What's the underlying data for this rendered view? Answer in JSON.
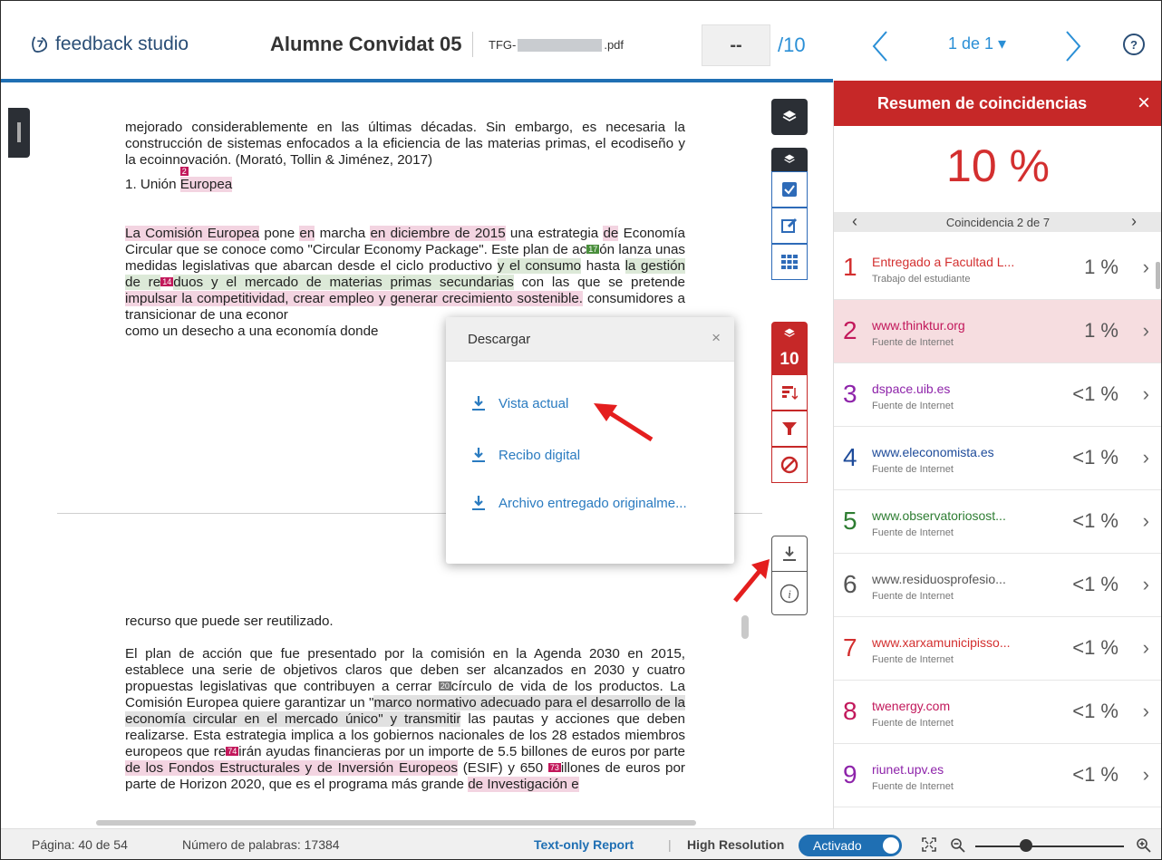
{
  "header": {
    "logo_text": "feedback studio",
    "student_name": "Alumne Convidat 05",
    "filename_prefix": "TFG-",
    "filename_suffix": ".pdf",
    "grade": "--",
    "grade_max": "/10",
    "page_selector": "1 de 1 ▾",
    "help": "?"
  },
  "document": {
    "para1": "mejorado considerablemente en las últimas décadas. Sin embargo, es necesaria la construcción de sistemas enfocados a la eficiencia de las materias primas, el ecodiseño y la ecoinnovación. (Morató, Tollin & Jiménez, 2017)",
    "heading_num": "1. Unión ",
    "heading_hl": "Europea",
    "heading_marker": "2",
    "p2a": "La Comisión Europea",
    "p2b": " pone ",
    "p2c": "en",
    "p2d": " marcha ",
    "p2e": "en diciembre de 2015",
    "p2f": " una estrategia ",
    "p2g": "de",
    "p2h": " Economía Circular que se conoce como \"Circular Economy Package\". Este plan de ac",
    "p2_marker1": "17",
    "p2i": "ón lanza unas medidas legislativas que abarcan desde el ciclo productivo ",
    "p2j": "y el consumo",
    "p2k": " hasta ",
    "p2l": "la gestión de re",
    "p2_marker2": "14",
    "p2m": "duos y el mercado de materias primas secundarias",
    "p2n": " con las que se pretende ",
    "p2o": "impulsar la competitividad, crear empleo y generar crecimiento sostenible.",
    "p2p": " consumidores a transicionar de una econor",
    "p2q": "como un desecho a una economía donde",
    "para3": "recurso que puede ser reutilizado.",
    "p4a": "El plan de acción que fue presentado por la comisión en la Agenda 2030 en 2015, establece una serie de objetivos claros que deben ser alcanzados en 2030 y cuatro propuestas legislativas que contribuyen a cerrar ",
    "p4_marker1": "20",
    "p4b": "círculo de vida de los productos. La Comisión Europea quiere garantizar un \"",
    "p4c": "marco normativo adecuado para el desarrollo de la economía circular en el mercado único\" y transmitir",
    "p4d": " las pautas y acciones que deben realizarse. Esta estrategia implica a los gobiernos nacionales de los 28 estados miembros europeos que re",
    "p4_marker2": "74",
    "p4e": "irán ayudas financieras por un importe de 5.5 billones de euros por parte ",
    "p4f": "de los Fondos Estructurales y de Inversión Europeos",
    "p4g": " (ESIF) y 650 ",
    "p4_marker3": "73",
    "p4h": "illones de euros por parte de Horizon 2020, que es el programa más grande ",
    "p4i": "de Investigación e"
  },
  "toolbar": {
    "similarity_number": "10"
  },
  "modal": {
    "title": "Descargar",
    "close": "×",
    "items": [
      {
        "label": "Vista actual"
      },
      {
        "label": "Recibo digital"
      },
      {
        "label": "Archivo entregado originalme..."
      }
    ]
  },
  "panel": {
    "title": "Resumen de coincidencias",
    "close": "×",
    "percentage": "10 %",
    "match_nav": "Coincidencia 2 de 7",
    "rows": [
      {
        "num": "1",
        "source": "Entregado a Facultad L...",
        "type": "Trabajo del estudiante",
        "pct": "1 %",
        "color": "#d32f2f"
      },
      {
        "num": "2",
        "source": "www.thinktur.org",
        "type": "Fuente de Internet",
        "pct": "1 %",
        "color": "#c2185b"
      },
      {
        "num": "3",
        "source": "dspace.uib.es",
        "type": "Fuente de Internet",
        "pct": "<1 %",
        "color": "#8e24aa"
      },
      {
        "num": "4",
        "source": "www.eleconomista.es",
        "type": "Fuente de Internet",
        "pct": "<1 %",
        "color": "#1e4b9a"
      },
      {
        "num": "5",
        "source": "www.observatoriosost...",
        "type": "Fuente de Internet",
        "pct": "<1 %",
        "color": "#2e7d32"
      },
      {
        "num": "6",
        "source": "www.residuosprofesio...",
        "type": "Fuente de Internet",
        "pct": "<1 %",
        "color": "#555555"
      },
      {
        "num": "7",
        "source": "www.xarxamunicipisso...",
        "type": "Fuente de Internet",
        "pct": "<1 %",
        "color": "#d32f2f"
      },
      {
        "num": "8",
        "source": "twenergy.com",
        "type": "Fuente de Internet",
        "pct": "<1 %",
        "color": "#c2185b"
      },
      {
        "num": "9",
        "source": "riunet.upv.es",
        "type": "Fuente de Internet",
        "pct": "<1 %",
        "color": "#8e24aa"
      }
    ]
  },
  "status": {
    "page": "Página: 40 de 54",
    "words": "Número de palabras: 17384",
    "text_only": "Text-only Report",
    "separator": "|",
    "high_res": "High Resolution",
    "toggle": "Activado"
  },
  "colors": {
    "accent_blue": "#1f6fb3",
    "match_red": "#c62828"
  }
}
